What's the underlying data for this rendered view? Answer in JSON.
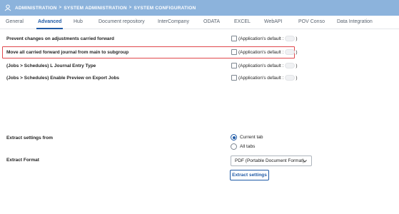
{
  "breadcrumb": {
    "items": [
      "ADMINISTRATION",
      "SYSTEM ADMINISTRATION",
      "SYSTEM CONFIGURATION"
    ],
    "separator": ">"
  },
  "tabs": [
    {
      "label": "General"
    },
    {
      "label": "Advanced",
      "active": true
    },
    {
      "label": "Hub"
    },
    {
      "label": "Document repository"
    },
    {
      "label": "InterCompany"
    },
    {
      "label": "ODATA"
    },
    {
      "label": "EXCEL"
    },
    {
      "label": "WebAPI"
    },
    {
      "label": "POV Conso"
    },
    {
      "label": "Data Integration"
    }
  ],
  "settings": [
    {
      "label": "Prevent changes on adjustments carried forward",
      "default_label": "(Application's default :",
      "default_close": ")"
    },
    {
      "label": "Move all carried forward journal from main to subgroup",
      "default_label": "(Application's default :",
      "default_close": ")"
    },
    {
      "label": "(Jobs > Schedules) L Journal Entry Type",
      "default_label": "(Application's default :",
      "default_close": ")"
    },
    {
      "label": "(Jobs > Schedules) Enable Preview on Export Jobs",
      "default_label": "(Application's default :",
      "default_close": ")"
    }
  ],
  "extract": {
    "settings_from_label": "Extract settings from",
    "options": [
      {
        "label": "Current tab",
        "selected": true
      },
      {
        "label": "All tabs",
        "selected": false
      }
    ],
    "format_label": "Extract Format",
    "format_value": "PDF (Portable Document Format)",
    "button_label": "Extract settings"
  },
  "colors": {
    "header": "#8cb3dc",
    "accent": "#1f5aa6",
    "highlight": "#e0474c"
  }
}
